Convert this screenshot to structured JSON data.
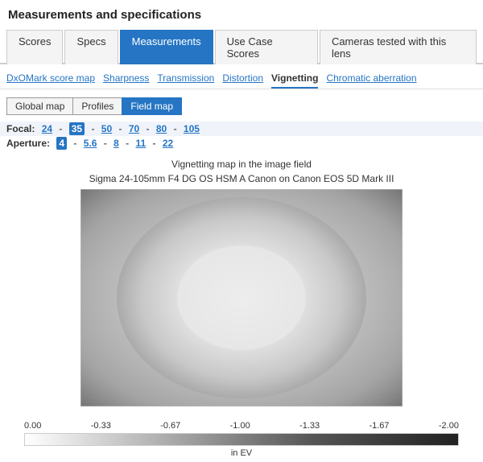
{
  "page": {
    "title": "Measurements and specifications"
  },
  "top_tabs": [
    {
      "label": "Scores",
      "active": false
    },
    {
      "label": "Specs",
      "active": false
    },
    {
      "label": "Measurements",
      "active": true
    },
    {
      "label": "Use Case Scores",
      "active": false
    },
    {
      "label": "Cameras tested with this lens",
      "active": false
    }
  ],
  "sub_tabs": [
    {
      "label": "DxOMark score map",
      "active": false
    },
    {
      "label": "Sharpness",
      "active": false
    },
    {
      "label": "Transmission",
      "active": false
    },
    {
      "label": "Distortion",
      "active": false
    },
    {
      "label": "Vignetting",
      "active": true
    },
    {
      "label": "Chromatic aberration",
      "active": false
    }
  ],
  "map_tabs": [
    {
      "label": "Global map",
      "active": false
    },
    {
      "label": "Profiles",
      "active": false
    },
    {
      "label": "Field map",
      "active": true
    }
  ],
  "focal": {
    "label": "Focal:",
    "values": [
      {
        "val": "24",
        "active": false
      },
      {
        "val": "35",
        "active": true
      },
      {
        "val": "50",
        "active": false
      },
      {
        "val": "70",
        "active": false
      },
      {
        "val": "80",
        "active": false
      },
      {
        "val": "105",
        "active": false
      }
    ]
  },
  "aperture": {
    "label": "Aperture:",
    "values": [
      {
        "val": "4",
        "active": true
      },
      {
        "val": "5.6",
        "active": false
      },
      {
        "val": "8",
        "active": false
      },
      {
        "val": "11",
        "active": false
      },
      {
        "val": "22",
        "active": false
      }
    ]
  },
  "chart": {
    "title_line1": "Vignetting map in the image field",
    "title_line2": "Sigma 24-105mm F4 DG OS HSM A Canon on Canon EOS 5D Mark III"
  },
  "legend": {
    "labels": [
      "0.00",
      "-0.33",
      "-0.67",
      "-1.00",
      "-1.33",
      "-1.67",
      "-2.00"
    ],
    "unit": "in EV"
  }
}
